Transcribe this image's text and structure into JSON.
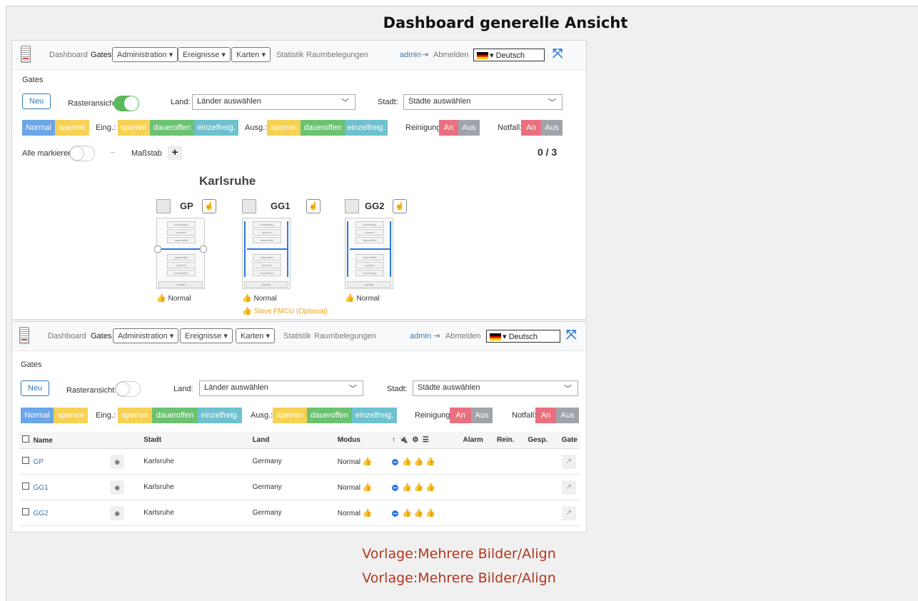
{
  "page": {
    "title": "Dashboard generelle Ansicht"
  },
  "nav": {
    "dashboard": "Dashboard",
    "gates": "Gates",
    "administration": "Administration ▾",
    "ereignisse": "Ereignisse ▾",
    "karten": "Karten ▾",
    "statistik": "Statistik",
    "raumbelegungen": "Raumbelegungen",
    "admin": "admin",
    "logout_icon": "sign-out-icon",
    "abmelden": "Abmelden",
    "language": "▾ Deutsch",
    "expand_icon": "expand-icon"
  },
  "gates_view": {
    "heading": "Gates",
    "new_button": "Neu",
    "raster_label": "Rasteransicht",
    "land_label": "Land:",
    "land_placeholder": "Länder auswählen",
    "stadt_label": "Stadt:",
    "stadt_placeholder": "Städte auswählen",
    "mode_normal": "Normal",
    "mode_sperren": "sperren",
    "eing_label": "Eing.:",
    "ausg_label": "Ausg.:",
    "sperren": "sperren",
    "daueroffen": "daueroffen",
    "einzelfreig": "einzelfreig.",
    "reinigung_label": "Reinigung:",
    "notfall_label": "Notfall:",
    "an": "An",
    "aus": "Aus",
    "alle_markieren": "Alle markieren",
    "minus": "−",
    "massstab": "Maßstab",
    "plus": "+",
    "count": "0 / 3",
    "city": "Karlsruhe",
    "gates": [
      {
        "name": "GP",
        "status": "Normal"
      },
      {
        "name": "GG1",
        "status": "Normal",
        "extra": "Slave FMCU (Optional)"
      },
      {
        "name": "GG2",
        "status": "Normal"
      }
    ],
    "gate_bars": [
      "einzelfreig.",
      "sperren",
      "daueroffen",
      "daueroffen",
      "sperren",
      "einzelfreig."
    ],
    "gate_footer": "normal"
  },
  "table": {
    "headers": [
      "Name",
      "Stadt",
      "Land",
      "Modus",
      "Alarm",
      "Rein.",
      "Gesp.",
      "Gate"
    ],
    "rows": [
      {
        "name": "GP",
        "stadt": "Karlsruhe",
        "land": "Germany",
        "modus": "Normal"
      },
      {
        "name": "GG1",
        "stadt": "Karlsruhe",
        "land": "Germany",
        "modus": "Normal"
      },
      {
        "name": "GG2",
        "stadt": "Karlsruhe",
        "land": "Germany",
        "modus": "Normal"
      }
    ]
  },
  "footer": {
    "template1": "Vorlage:Mehrere Bilder/Align",
    "template2": "Vorlage:Mehrere Bilder/Align"
  },
  "colors": {
    "blue": "#6aa6e8",
    "yellow": "#f7d154",
    "green": "#6cc271",
    "teal": "#6ec1cf",
    "red": "#e8707f",
    "gray": "#9ea4a9",
    "link": "#b3361e"
  }
}
